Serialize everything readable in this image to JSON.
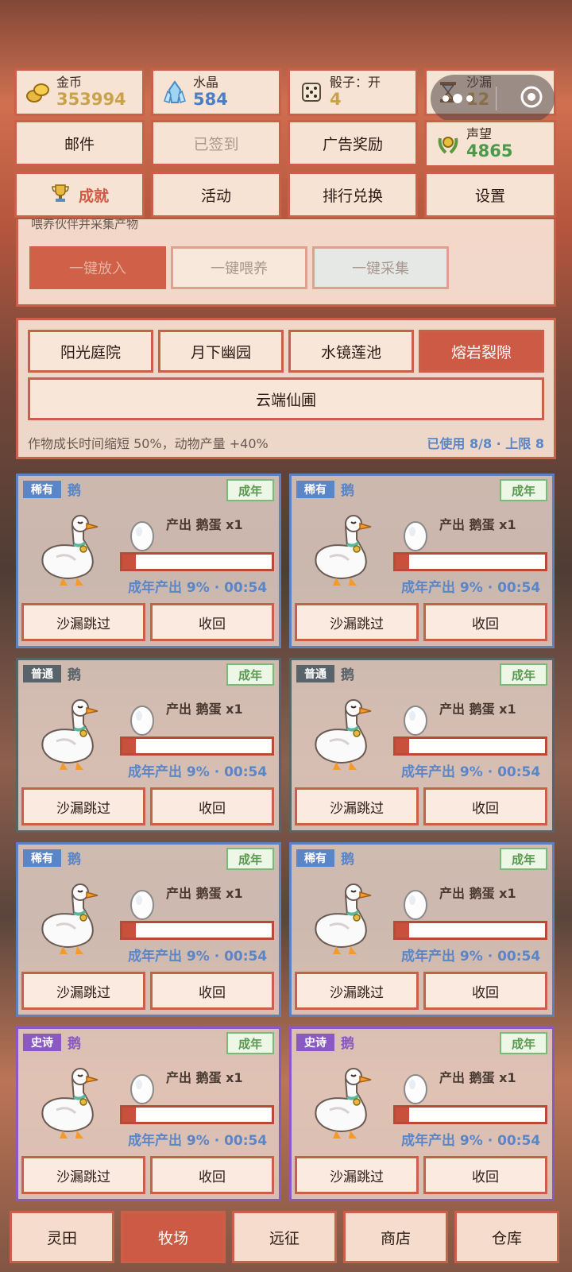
{
  "stats": {
    "gold": {
      "label": "金币",
      "value": "353994"
    },
    "crystal": {
      "label": "水晶",
      "value": "584"
    },
    "dice": {
      "label": "骰子：开",
      "value": "4"
    },
    "hourglass": {
      "label": "沙漏",
      "value": "12"
    },
    "prestige": {
      "label": "声望",
      "value": "4865"
    }
  },
  "menu": {
    "mail": "邮件",
    "signed": "已签到",
    "ad_reward": "广告奖励",
    "achievement": "成就",
    "activity": "活动",
    "rank_exchange": "排行兑换",
    "settings": "设置"
  },
  "feed_panel": {
    "hint": "喂养伙伴并采集产物",
    "put_all": "一键放入",
    "feed_all": "一键喂养",
    "collect_all": "一键采集"
  },
  "zones": {
    "tabs": [
      "阳光庭院",
      "月下幽园",
      "水镜莲池",
      "熔岩裂隙",
      "云端仙圃"
    ],
    "active_index": 3,
    "effect": "作物成长时间缩短 50%，动物产量 +40%",
    "capacity": "已使用 8/8 · 上限 8"
  },
  "animals": [
    {
      "rarity": "稀有",
      "name": "鹅",
      "stage": "成年",
      "output": "产出 鹅蛋 x1",
      "progress_text": "成年产出 9% · 00:54",
      "progress": 0.09,
      "skip": "沙漏跳过",
      "recall": "收回"
    },
    {
      "rarity": "稀有",
      "name": "鹅",
      "stage": "成年",
      "output": "产出 鹅蛋 x1",
      "progress_text": "成年产出 9% · 00:54",
      "progress": 0.09,
      "skip": "沙漏跳过",
      "recall": "收回"
    },
    {
      "rarity": "普通",
      "name": "鹅",
      "stage": "成年",
      "output": "产出 鹅蛋 x1",
      "progress_text": "成年产出 9% · 00:54",
      "progress": 0.09,
      "skip": "沙漏跳过",
      "recall": "收回"
    },
    {
      "rarity": "普通",
      "name": "鹅",
      "stage": "成年",
      "output": "产出 鹅蛋 x1",
      "progress_text": "成年产出 9% · 00:54",
      "progress": 0.09,
      "skip": "沙漏跳过",
      "recall": "收回"
    },
    {
      "rarity": "稀有",
      "name": "鹅",
      "stage": "成年",
      "output": "产出 鹅蛋 x1",
      "progress_text": "成年产出 9% · 00:54",
      "progress": 0.09,
      "skip": "沙漏跳过",
      "recall": "收回"
    },
    {
      "rarity": "稀有",
      "name": "鹅",
      "stage": "成年",
      "output": "产出 鹅蛋 x1",
      "progress_text": "成年产出 9% · 00:54",
      "progress": 0.09,
      "skip": "沙漏跳过",
      "recall": "收回"
    },
    {
      "rarity": "史诗",
      "name": "鹅",
      "stage": "成年",
      "output": "产出 鹅蛋 x1",
      "progress_text": "成年产出 9% · 00:54",
      "progress": 0.09,
      "skip": "沙漏跳过",
      "recall": "收回"
    },
    {
      "rarity": "史诗",
      "name": "鹅",
      "stage": "成年",
      "output": "产出 鹅蛋 x1",
      "progress_text": "成年产出 9% · 00:54",
      "progress": 0.09,
      "skip": "沙漏跳过",
      "recall": "收回"
    }
  ],
  "nav": {
    "items": [
      "灵田",
      "牧场",
      "远征",
      "商店",
      "仓库"
    ],
    "active_index": 1
  },
  "colors": {
    "accent": "#cc5a44",
    "rare": "#5a86c8",
    "common": "#58636a",
    "epic": "#8a5ac2",
    "gold_value": "#c9a24a",
    "crystal_value": "#4a7fc8",
    "green_value": "#4a9a4a"
  },
  "icons": {
    "gold": "gold-coins-icon",
    "crystal": "crystal-icon",
    "dice": "dice-icon",
    "hourglass": "hourglass-icon",
    "prestige": "laurel-medal-icon",
    "achievement": "trophy-icon",
    "capsule_more": "more-dots-icon",
    "capsule_close": "close-circle-icon"
  }
}
